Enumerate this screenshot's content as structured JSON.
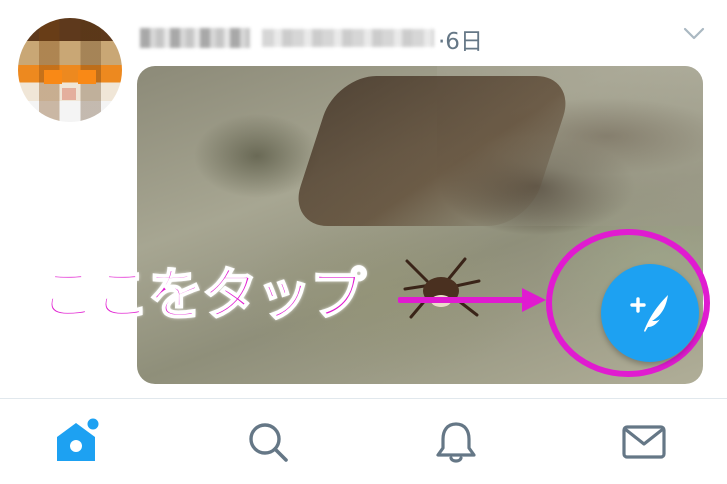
{
  "tweet": {
    "time": "·6日"
  },
  "annotation": {
    "text": "ここをタップ",
    "color": "#e01bd0"
  },
  "fab": {
    "icon": "compose-tweet-icon",
    "color": "#1da1f2"
  },
  "tabbar": {
    "items": [
      {
        "icon": "home-icon",
        "active": true
      },
      {
        "icon": "search-icon",
        "active": false
      },
      {
        "icon": "notifications-bell-icon",
        "active": false
      },
      {
        "icon": "messages-envelope-icon",
        "active": false
      }
    ],
    "active_color": "#1da1f2",
    "inactive_color": "#657786"
  }
}
